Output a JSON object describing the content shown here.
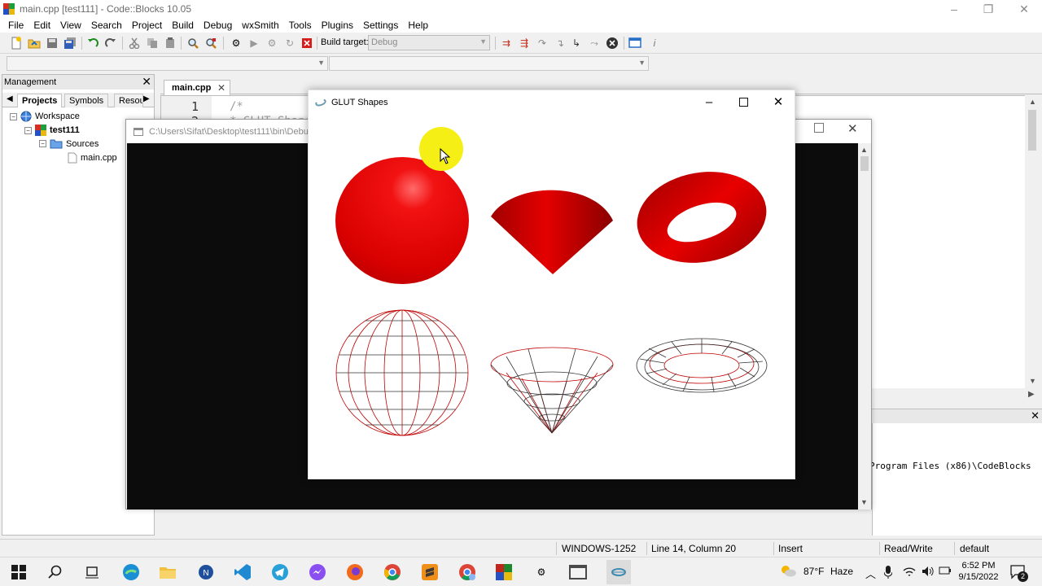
{
  "window": {
    "title": "main.cpp [test111] - Code::Blocks 10.05",
    "controls": {
      "minimize": "–",
      "maximize": "❐",
      "close": "✕"
    }
  },
  "menu": [
    "File",
    "Edit",
    "View",
    "Search",
    "Project",
    "Build",
    "Debug",
    "wxSmith",
    "Tools",
    "Plugins",
    "Settings",
    "Help"
  ],
  "toolbar": {
    "build_target_label": "Build target:",
    "build_target_value": "Debug"
  },
  "management": {
    "title": "Management",
    "tabs": [
      "Projects",
      "Symbols",
      "Resou"
    ],
    "tree": {
      "workspace": "Workspace",
      "project": "test111",
      "folder": "Sources",
      "file": "main.cpp"
    }
  },
  "editor": {
    "tab_label": "main.cpp",
    "line_numbers": [
      "1",
      "2"
    ],
    "code_lines": [
      "/*",
      " * GLUT Shapes Demo"
    ]
  },
  "console": {
    "title": "C:\\Users\\Sifat\\Desktop\\test111\\bin\\Debu"
  },
  "glut": {
    "title": "GLUT Shapes"
  },
  "logs": {
    "line": "Program Files (x86)\\CodeBlocks"
  },
  "statusbar": {
    "encoding": "WINDOWS-1252",
    "position": "Line 14, Column 20",
    "mode": "Insert",
    "access": "Read/Write",
    "lang": "default"
  },
  "taskbar": {
    "weather_temp": "87°F",
    "weather_desc": "Haze",
    "time": "6:52 PM",
    "date": "9/15/2022",
    "notifications": "2"
  },
  "colors": {
    "solid_shape": "#d80000",
    "wire_shape": "#c00000",
    "cursor_highlight": "#f5ef15"
  },
  "icons": [
    "windows-start-icon",
    "search-icon",
    "task-view-icon",
    "edge-icon",
    "file-explorer-icon",
    "notepad-app-icon",
    "vscode-icon",
    "telegram-icon",
    "messenger-icon",
    "firefox-icon",
    "chrome-icon",
    "sublime-icon",
    "chrome-profile-icon",
    "winrar-icon",
    "settings-icon",
    "terminal-icon",
    "codeblocks-icon"
  ]
}
